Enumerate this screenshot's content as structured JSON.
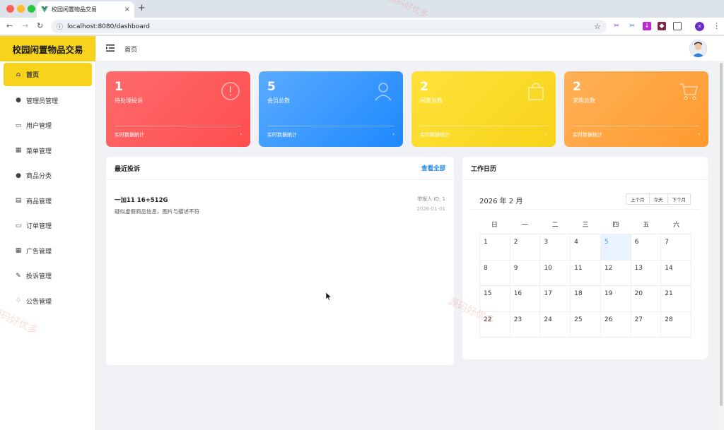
{
  "browser": {
    "tab_title": "校园闲置物品交易",
    "url": "localhost:8080/dashboard",
    "profile_initial": "x"
  },
  "app": {
    "brand": "校园闲置物品交易",
    "breadcrumb": "首页",
    "accent_color": "#f7d41b"
  },
  "sidebar": {
    "items": [
      {
        "label": "首页",
        "icon": "home-icon",
        "active": true
      },
      {
        "label": "管理员管理",
        "icon": "user-icon",
        "active": false
      },
      {
        "label": "用户管理",
        "icon": "folder-icon",
        "active": false
      },
      {
        "label": "菜单管理",
        "icon": "grid-icon",
        "active": false
      },
      {
        "label": "商品分类",
        "icon": "user-icon",
        "active": false
      },
      {
        "label": "商品管理",
        "icon": "document-icon",
        "active": false
      },
      {
        "label": "订单管理",
        "icon": "monitor-icon",
        "active": false
      },
      {
        "label": "广告管理",
        "icon": "calendar-icon",
        "active": false
      },
      {
        "label": "投诉管理",
        "icon": "edit-icon",
        "active": false
      },
      {
        "label": "公告管理",
        "icon": "bell-icon",
        "active": false
      }
    ]
  },
  "stats": [
    {
      "value": "1",
      "label": "待处理投诉",
      "footer": "实时数据统计",
      "icon": "warning-icon",
      "color_from": "#ff6b6b",
      "color_to": "#ff4d4f"
    },
    {
      "value": "5",
      "label": "会员总数",
      "footer": "实时数据统计",
      "icon": "user-icon",
      "color_from": "#5aabff",
      "color_to": "#1e88ff"
    },
    {
      "value": "2",
      "label": "闲置总数",
      "footer": "实时数据统计",
      "icon": "bag-icon",
      "color_from": "#ffe23a",
      "color_to": "#f7d41b"
    },
    {
      "value": "2",
      "label": "求购总数",
      "footer": "实时数据统计",
      "icon": "cart-icon",
      "color_from": "#ffb156",
      "color_to": "#ff9a2f"
    }
  ],
  "complaints": {
    "title": "最近投诉",
    "view_all": "查看全部",
    "items": [
      {
        "title": "一加11 16+512G",
        "desc": "疑似虚假商品信息，图片与描述不符",
        "reporter": "举报人 ID: 1",
        "date": "2026-01-01"
      }
    ]
  },
  "calendar": {
    "title": "工作日历",
    "month_label": "2026 年 2 月",
    "buttons": [
      "上个月",
      "今天",
      "下个月"
    ],
    "weekdays": [
      "日",
      "一",
      "二",
      "三",
      "四",
      "五",
      "六"
    ],
    "days": [
      "1",
      "2",
      "3",
      "4",
      "5",
      "6",
      "7",
      "8",
      "9",
      "10",
      "11",
      "12",
      "13",
      "14",
      "15",
      "16",
      "17",
      "18",
      "19",
      "20",
      "21",
      "22",
      "23",
      "24",
      "25",
      "26",
      "27",
      "28"
    ],
    "today": "5"
  },
  "watermark": "源码好优多"
}
